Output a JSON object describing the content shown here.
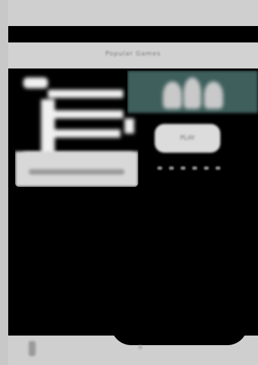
{
  "title": "Popular Games",
  "left_card": {
    "caption": ""
  },
  "right_card": {
    "button_label": "PLAY"
  },
  "colors": {
    "background": "#000000",
    "chrome": "#cfcfcf",
    "accent_teal": "#3e5f5c",
    "text_muted": "#7a7a7a"
  },
  "icons": [
    "back-icon",
    "bottom-dot-icon"
  ]
}
